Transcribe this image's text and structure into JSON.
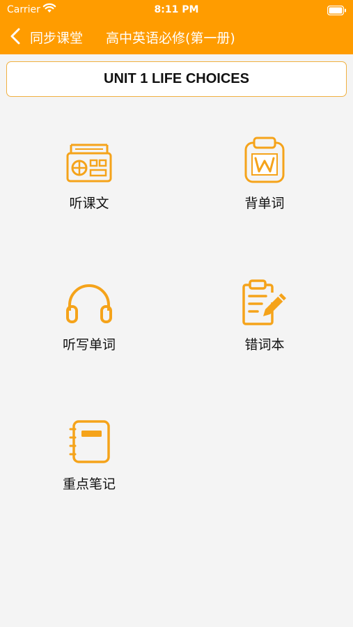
{
  "status_bar": {
    "carrier": "Carrier",
    "time": "8:11 PM"
  },
  "nav": {
    "back_label": "同步课堂",
    "title": "高中英语必修(第一册)"
  },
  "unit": {
    "title": "UNIT 1 LIFE CHOICES"
  },
  "features": [
    {
      "label": "听课文",
      "icon": "radio-icon"
    },
    {
      "label": "背单词",
      "icon": "word-clipboard-icon"
    },
    {
      "label": "听写单词",
      "icon": "headphones-icon"
    },
    {
      "label": "错词本",
      "icon": "notepad-pencil-icon"
    },
    {
      "label": "重点笔记",
      "icon": "notebook-icon"
    }
  ],
  "colors": {
    "accent": "#ff9c00",
    "icon": "#f5a31a",
    "background": "#f4f4f4"
  }
}
